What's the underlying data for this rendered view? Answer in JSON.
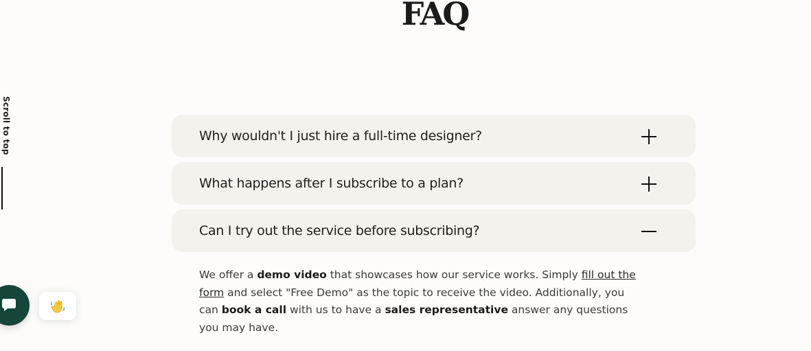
{
  "page": {
    "title": "FAQ"
  },
  "scroll_top": {
    "label": "Scroll to top"
  },
  "faq": {
    "items": [
      {
        "question": "Why wouldn't I just hire a full-time designer?",
        "expanded": false,
        "toggle_icon": "plus-icon"
      },
      {
        "question": "What happens after I subscribe to a plan?",
        "expanded": false,
        "toggle_icon": "plus-icon"
      },
      {
        "question": "Can I try out the service before subscribing?",
        "expanded": true,
        "toggle_icon": "minus-icon"
      }
    ],
    "answer": {
      "t1": "We offer a ",
      "b1": "demo video",
      "t2": " that showcases how our service works. Simply ",
      "link": "fill out the form",
      "t3": " and select \"Free Demo\" as the topic to receive the video. Additionally, you can ",
      "b2": "book a call",
      "t4": " with us to have a ",
      "b3": "sales representative",
      "t5": " answer any questions you may have."
    }
  },
  "widgets": {
    "chat_icon": "chat-bubble-icon",
    "wave_icon": "waving-hand-icon"
  },
  "colors": {
    "background": "#fdfcfa",
    "card": "#f4f2ec",
    "chat_button": "#16453a"
  }
}
